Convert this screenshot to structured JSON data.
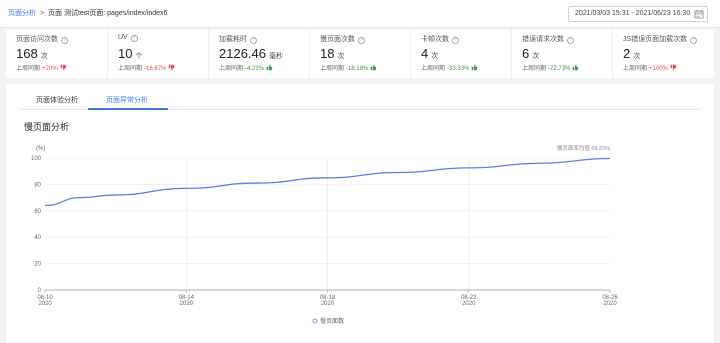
{
  "breadcrumb": {
    "root": "页面分析",
    "separator": ">",
    "current": "页面 测试test页面: pages/index/index6"
  },
  "date_range": {
    "value": "2021/03/03 15:31 - 2021/06/23 16:30",
    "icon": "calendar-icon"
  },
  "metrics": [
    {
      "name": "页面访问次数",
      "value": "168",
      "unit": "次",
      "compare_label": "上周同期",
      "compare_value": "+20%",
      "trend_icon": "thumb-down-icon",
      "trend_color": "#f04848"
    },
    {
      "name": "UV",
      "value": "10",
      "unit": "个",
      "compare_label": "上周同期",
      "compare_value": "-16.67%",
      "trend_icon": "thumb-down-icon",
      "trend_color": "#f04848"
    },
    {
      "name": "加载耗时",
      "value": "2126.46",
      "unit": "毫秒",
      "compare_label": "上周同期",
      "compare_value": "-4.23%",
      "trend_icon": "thumb-up-icon",
      "trend_color": "#3a9b3a"
    },
    {
      "name": "慢页面次数",
      "value": "18",
      "unit": "次",
      "compare_label": "上周同期",
      "compare_value": "-18.18%",
      "trend_icon": "thumb-up-icon",
      "trend_color": "#3a9b3a"
    },
    {
      "name": "卡顿次数",
      "value": "4",
      "unit": "次",
      "compare_label": "上周同期",
      "compare_value": "-33.33%",
      "trend_icon": "thumb-up-icon",
      "trend_color": "#3a9b3a"
    },
    {
      "name": "错误请求次数",
      "value": "6",
      "unit": "次",
      "compare_label": "上周同期",
      "compare_value": "-72.73%",
      "trend_icon": "thumb-up-icon",
      "trend_color": "#3a9b3a"
    },
    {
      "name": "JS错误页面加载次数",
      "value": "2",
      "unit": "次",
      "compare_label": "上周同期",
      "compare_value": "+100%",
      "trend_icon": "thumb-down-icon",
      "trend_color": "#f04848"
    }
  ],
  "tabs": [
    {
      "label": "页面体验分析",
      "active": false
    },
    {
      "label": "页面异常分析",
      "active": true
    }
  ],
  "section_title": "慢页面分析",
  "chart_data": {
    "type": "line",
    "ylabel": "(%)",
    "ylim": [
      0,
      100
    ],
    "yticks": [
      0,
      20,
      40,
      60,
      80,
      100
    ],
    "xticks": [
      {
        "date": "08-10",
        "year": "2020"
      },
      {
        "date": "08-14",
        "year": "2020"
      },
      {
        "date": "08-18",
        "year": "2020"
      },
      {
        "date": "08-22",
        "year": "2020"
      },
      {
        "date": "08-26",
        "year": "2020"
      }
    ],
    "x": [
      "2020-08-10",
      "2020-08-11",
      "2020-08-12",
      "2020-08-14",
      "2020-08-16",
      "2020-08-18",
      "2020-08-20",
      "2020-08-22",
      "2020-08-24",
      "2020-08-26"
    ],
    "series": [
      {
        "name": "慢页面数",
        "values": [
          64,
          70,
          72,
          77,
          81,
          85,
          89,
          92.5,
          96,
          99.6
        ],
        "color": "#5b7fe0"
      }
    ],
    "annotation": "慢页面率均值 69.23%",
    "legend": "bottom-center",
    "grid": true
  }
}
